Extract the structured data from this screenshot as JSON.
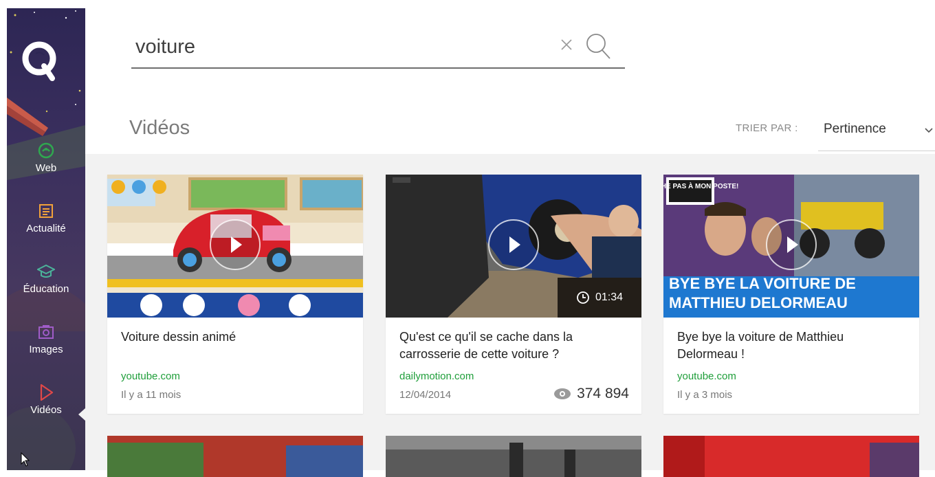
{
  "sidebar": {
    "items": [
      {
        "label": "Web",
        "icon": "web-icon",
        "color": "#2fa84f"
      },
      {
        "label": "Actualité",
        "icon": "news-icon",
        "color": "#f2a23a"
      },
      {
        "label": "Éducation",
        "icon": "graduation-cap-icon",
        "color": "#4bb39a"
      },
      {
        "label": "Images",
        "icon": "camera-icon",
        "color": "#a05cc8"
      },
      {
        "label": "Vidéos",
        "icon": "play-outline-icon",
        "color": "#e04848"
      }
    ],
    "active": "Vidéos"
  },
  "search": {
    "value": "voiture",
    "clear_icon": "close-icon",
    "search_icon": "search-icon"
  },
  "section": {
    "title": "Vidéos",
    "sort_label": "TRIER PAR :",
    "sort_value": "Pertinence"
  },
  "results": [
    {
      "title": "Voiture dessin animé",
      "source": "youtube.com",
      "date": "Il y a 11 mois",
      "duration": "",
      "views": ""
    },
    {
      "title": "Qu'est ce qu'il se cache dans la carrosserie de cette voiture ?",
      "source": "dailymotion.com",
      "date": "12/04/2014",
      "duration": "01:34",
      "views": "374 894"
    },
    {
      "title": "Bye bye la voiture de Matthieu Delormeau !",
      "source": "youtube.com",
      "date": "Il y a 3 mois",
      "duration": "",
      "views": "",
      "thumb_text": {
        "badge": "TOUCHE PAS À MON POSTE!",
        "line1": "BYE BYE LA VOITURE DE",
        "line2": "MATTHIEU DELORMEAU"
      }
    }
  ],
  "colors": {
    "accent_green": "#1f9e3a",
    "sidebar_bg": "#2d2654",
    "grid_bg": "#f2f2f2"
  }
}
